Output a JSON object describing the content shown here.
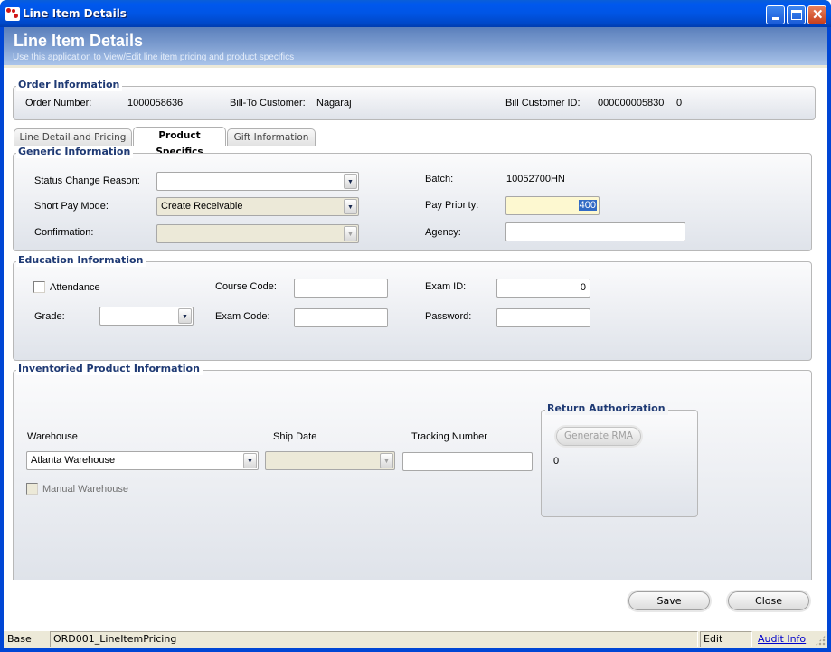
{
  "window": {
    "title": "Line Item Details",
    "controls": {
      "minimize": "_",
      "maximize": "□",
      "close": "✕"
    }
  },
  "banner": {
    "title": "Line Item Details",
    "subtitle": "Use this application to View/Edit line item pricing and product specifics"
  },
  "order_info": {
    "legend": "Order Information",
    "order_number_label": "Order Number:",
    "order_number": "1000058636",
    "bill_to_label": "Bill-To Customer:",
    "bill_to": "Nagaraj",
    "bill_customer_id_label": "Bill Customer ID:",
    "bill_customer_id": "000000005830",
    "bill_customer_suffix": "0"
  },
  "tabs": [
    {
      "label": "Line Detail and Pricing",
      "active": false
    },
    {
      "label": "Product Specifics",
      "active": true
    },
    {
      "label": "Gift Information",
      "active": false
    }
  ],
  "generic": {
    "legend": "Generic Information",
    "status_change_reason_label": "Status Change Reason:",
    "status_change_reason_value": "",
    "short_pay_mode_label": "Short Pay Mode:",
    "short_pay_mode_value": "Create Receivable",
    "confirmation_label": "Confirmation:",
    "confirmation_value": "",
    "batch_label": "Batch:",
    "batch_value": "10052700HN",
    "pay_priority_label": "Pay Priority:",
    "pay_priority_value": "400",
    "agency_label": "Agency:",
    "agency_value": ""
  },
  "education": {
    "legend": "Education Information",
    "attendance_label": "Attendance",
    "attendance_checked": false,
    "grade_label": "Grade:",
    "grade_value": "",
    "course_code_label": "Course Code:",
    "course_code_value": "",
    "exam_code_label": "Exam Code:",
    "exam_code_value": "",
    "exam_id_label": "Exam ID:",
    "exam_id_value": "0",
    "password_label": "Password:",
    "password_value": ""
  },
  "inventory": {
    "legend": "Inventoried Product Information",
    "warehouse_label": "Warehouse",
    "warehouse_value": "Atlanta Warehouse",
    "ship_date_label": "Ship Date",
    "ship_date_value": "",
    "tracking_label": "Tracking Number",
    "tracking_value": "",
    "manual_warehouse_label": "Manual Warehouse",
    "manual_warehouse_checked": false
  },
  "rma": {
    "legend": "Return Authorization",
    "generate_label": "Generate RMA",
    "value": "0"
  },
  "actions": {
    "save": "Save",
    "close": "Close"
  },
  "statusbar": {
    "base": "Base",
    "screen_id": "ORD001_LineItemPricing",
    "mode": "Edit",
    "audit_link": "Audit Info"
  },
  "colors": {
    "accent": "#1f3a74",
    "titlebar": "#0055e5",
    "highlight_field": "#fdf8d0",
    "selection": "#316ac5"
  }
}
